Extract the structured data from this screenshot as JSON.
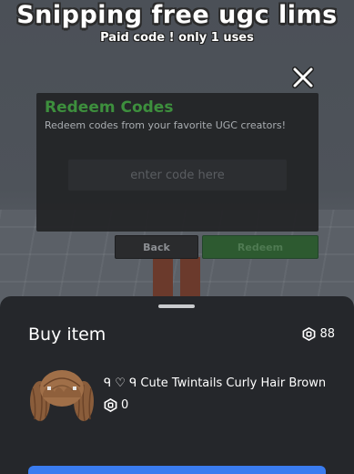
{
  "overlay": {
    "title": "Snipping free ugc lims",
    "subtitle": "Paid code ! only 1 uses"
  },
  "redeem_dialog": {
    "title": "Redeem Codes",
    "description": "Redeem codes from your favorite UGC creators!",
    "input_placeholder": "enter code here",
    "input_value": "",
    "back_label": "Back",
    "redeem_label": "Redeem",
    "close_icon": "close-icon"
  },
  "buy_sheet": {
    "title": "Buy item",
    "balance": "88",
    "balance_icon": "robux-icon",
    "item": {
      "name": "ᑫ ♡ ᑫ Cute Twintails Curly Hair Brown",
      "price": "0",
      "price_icon": "robux-icon",
      "thumbnail_icon": "hair-thumbnail"
    }
  },
  "colors": {
    "redeem_title": "#3d8f3d",
    "redeem_button": "#2d5a30",
    "buy_button": "#3a7cf0",
    "sheet_background": "#25272b"
  }
}
